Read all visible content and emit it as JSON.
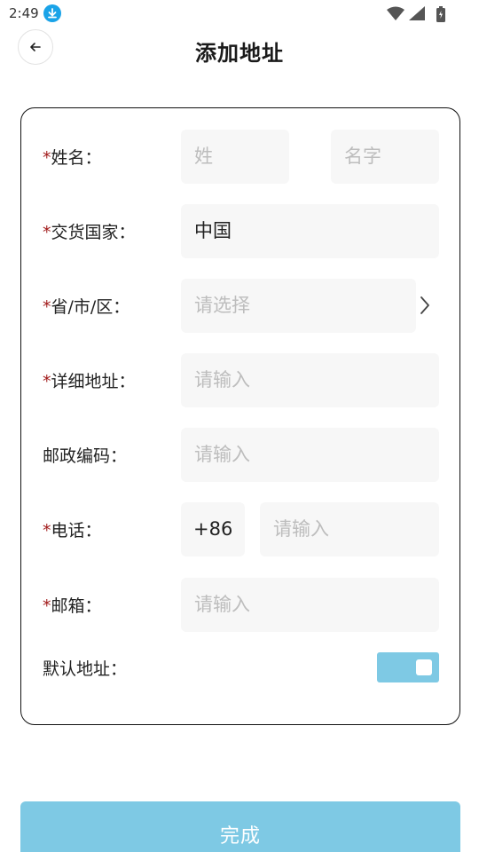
{
  "status_bar": {
    "time": "2:49"
  },
  "header": {
    "title": "添加地址"
  },
  "form": {
    "required_mark": "*",
    "fields": {
      "name": {
        "label": "姓名：",
        "required": true,
        "surname_placeholder": "姓",
        "given_placeholder": "名字"
      },
      "country": {
        "label": "交货国家：",
        "required": true,
        "value": "中国"
      },
      "region": {
        "label": "省/市/区：",
        "required": true,
        "placeholder": "请选择"
      },
      "address": {
        "label": "详细地址：",
        "required": true,
        "placeholder": "请输入"
      },
      "postcode": {
        "label": "邮政编码：",
        "required": false,
        "placeholder": "请输入"
      },
      "phone": {
        "label": "电话：",
        "required": true,
        "country_code": "+86",
        "placeholder": "请输入"
      },
      "email": {
        "label": "邮箱：",
        "required": true,
        "placeholder": "请输入"
      },
      "default": {
        "label": "默认地址：",
        "enabled": true
      }
    }
  },
  "submit": {
    "label": "完成"
  },
  "colors": {
    "accent": "#7ec9e4",
    "required": "#a11b1b",
    "field_bg": "#f7f7f7",
    "placeholder": "#bdbdbd"
  }
}
